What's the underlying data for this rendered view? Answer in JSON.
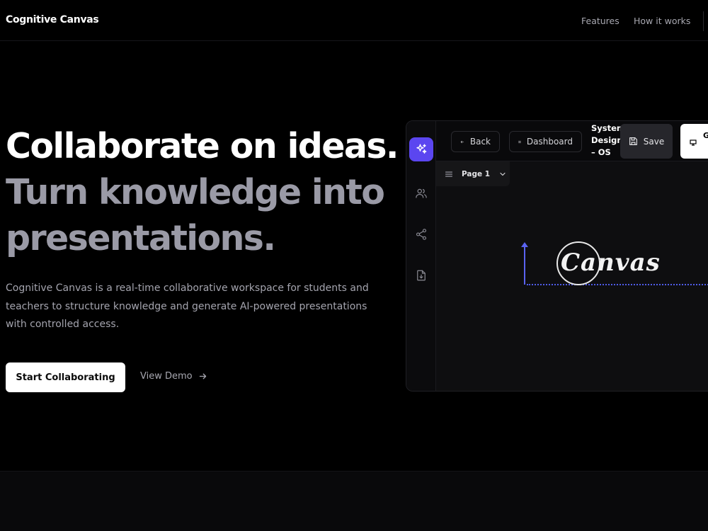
{
  "brand": "Cognitive Canvas",
  "nav": {
    "features": "Features",
    "how_it_works": "How it works"
  },
  "hero": {
    "title_line1": "Collaborate on ideas.",
    "title_line2": "Turn knowledge into",
    "title_line3": "presentations.",
    "description": "Cognitive Canvas is a real-time collaborative workspace for students and teachers to structure knowledge and generate AI-powered presentations with controlled access.",
    "primary_cta": "Start Collaborating",
    "secondary_cta": "View Demo"
  },
  "app": {
    "back": "Back",
    "dashboard": "Dashboard",
    "doc_title": "System Design – OS",
    "save": "Save",
    "present": "G",
    "page_selector": "Page 1",
    "canvas_text": "Canvas"
  },
  "colors": {
    "accent": "#5b46f0",
    "background": "#000000",
    "muted_text": "#a4a4ae",
    "heading_secondary": "#9a9aa6"
  },
  "icons": {
    "ai": "sparkles-icon",
    "users": "users-icon",
    "share": "share-icon",
    "export": "file-download-icon",
    "back": "arrow-left-icon",
    "dashboard": "grid-icon",
    "save": "save-icon",
    "menu": "menu-icon",
    "chevron": "chevron-down-icon",
    "arrow": "arrow-right-icon"
  }
}
